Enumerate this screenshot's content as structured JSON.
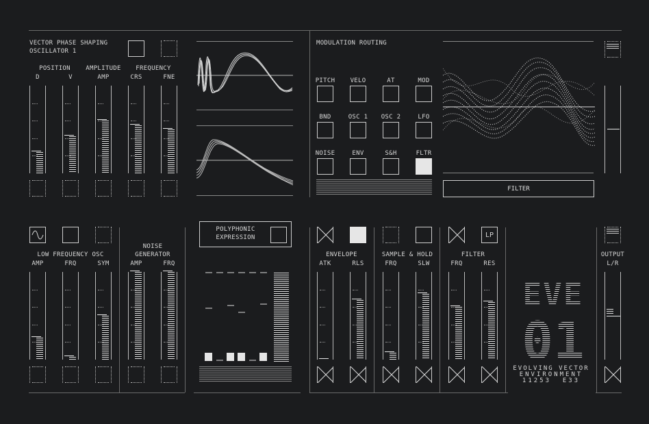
{
  "osc": {
    "title_line1": "VECTOR PHASE SHAPING",
    "title_line2": "OSCILLATOR 1",
    "groups": [
      "POSITION",
      "AMPLITUDE",
      "FREQUENCY"
    ],
    "sliders": [
      {
        "label": "D",
        "value": 0.24
      },
      {
        "label": "V",
        "value": 0.42
      },
      {
        "label": "AMP",
        "value": 0.6
      },
      {
        "label": "CRS",
        "value": 0.55
      },
      {
        "label": "FNE",
        "value": 0.5
      }
    ]
  },
  "mod": {
    "title": "MODULATION ROUTING",
    "sources": [
      {
        "label": "PITCH",
        "active": false
      },
      {
        "label": "VELO",
        "active": false
      },
      {
        "label": "AT",
        "active": false
      },
      {
        "label": "MOD",
        "active": false
      },
      {
        "label": "BND",
        "active": false
      },
      {
        "label": "OSC 1",
        "active": false
      },
      {
        "label": "OSC 2",
        "active": false
      },
      {
        "label": "LFO",
        "active": false
      },
      {
        "label": "NOISE",
        "active": false
      },
      {
        "label": "ENV",
        "active": false
      },
      {
        "label": "S&H",
        "active": false
      },
      {
        "label": "FLTR",
        "active": true
      }
    ],
    "target_label": "FILTER"
  },
  "lfo": {
    "title": "LOW FREQUENCY OSC",
    "sliders": [
      {
        "label": "AMP",
        "value": 0.25
      },
      {
        "label": "FRQ",
        "value": 0.03
      },
      {
        "label": "SYM",
        "value": 0.5
      }
    ]
  },
  "noise": {
    "title_line1": "NOISE",
    "title_line2": "GENERATOR",
    "sliders": [
      {
        "label": "AMP",
        "value": 1.0
      },
      {
        "label": "FRQ",
        "value": 1.0
      }
    ]
  },
  "poly": {
    "title_line1": "POLYPHONIC",
    "title_line2": "EXPRESSION"
  },
  "env": {
    "title": "ENVELOPE",
    "sliders": [
      {
        "label": "ATK",
        "value": 0.0
      },
      {
        "label": "RLS",
        "value": 0.68
      }
    ]
  },
  "sh": {
    "title": "SAMPLE & HOLD",
    "sliders": [
      {
        "label": "FRQ",
        "value": 0.08
      },
      {
        "label": "SLW",
        "value": 0.75
      }
    ]
  },
  "filter": {
    "title": "FILTER",
    "mode": "LP",
    "sliders": [
      {
        "label": "FRQ",
        "value": 0.6
      },
      {
        "label": "RES",
        "value": 0.66
      }
    ]
  },
  "output": {
    "title": "OUTPUT",
    "sub": "L/R",
    "value": 0.5
  },
  "brand": {
    "logo_top": "EVE",
    "logo_num": "01",
    "line1": "EVOLVING VECTOR",
    "line2": "ENVIRONMENT",
    "line3": "11253  E33"
  }
}
